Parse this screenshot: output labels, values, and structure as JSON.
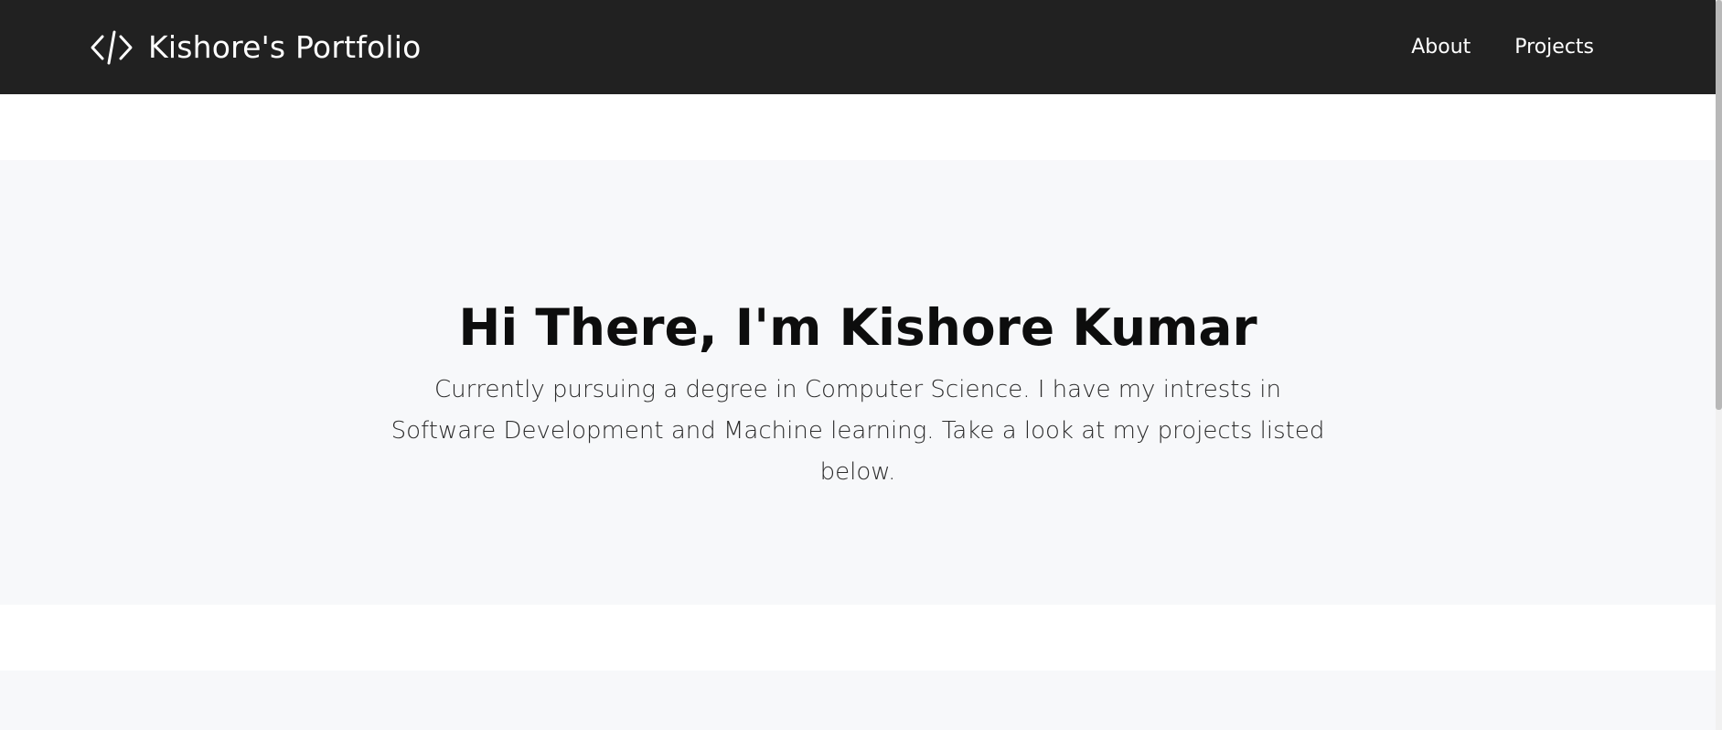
{
  "navbar": {
    "brand_icon": "code-icon",
    "brand_title": "Kishore's Portfolio",
    "links": [
      {
        "label": "About"
      },
      {
        "label": "Projects"
      }
    ]
  },
  "hero": {
    "title": "Hi There, I'm Kishore Kumar",
    "subtitle": "Currently pursuing a degree in Computer Science. I have my intrests in Software Development and Machine learning. Take a look at my projects listed below."
  },
  "colors": {
    "navbar_bg": "#212121",
    "hero_bg": "#f7f8fa",
    "text_dark": "#0d0d0d"
  }
}
